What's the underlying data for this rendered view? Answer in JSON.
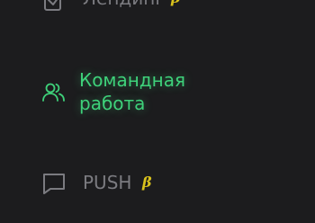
{
  "sidebar": {
    "items": [
      {
        "label": "Лендинг",
        "icon": "landing-page-icon",
        "beta": "β",
        "active": false
      },
      {
        "label": "Командная работа",
        "icon": "team-users-icon",
        "beta": "",
        "active": true
      },
      {
        "label": "PUSH",
        "icon": "chat-bubble-icon",
        "beta": "β",
        "active": false
      }
    ]
  },
  "colors": {
    "background": "#1c1c1e",
    "inactive_text": "#7b7b80",
    "active_text": "#3ed17a",
    "beta_badge": "#d9c21c"
  }
}
